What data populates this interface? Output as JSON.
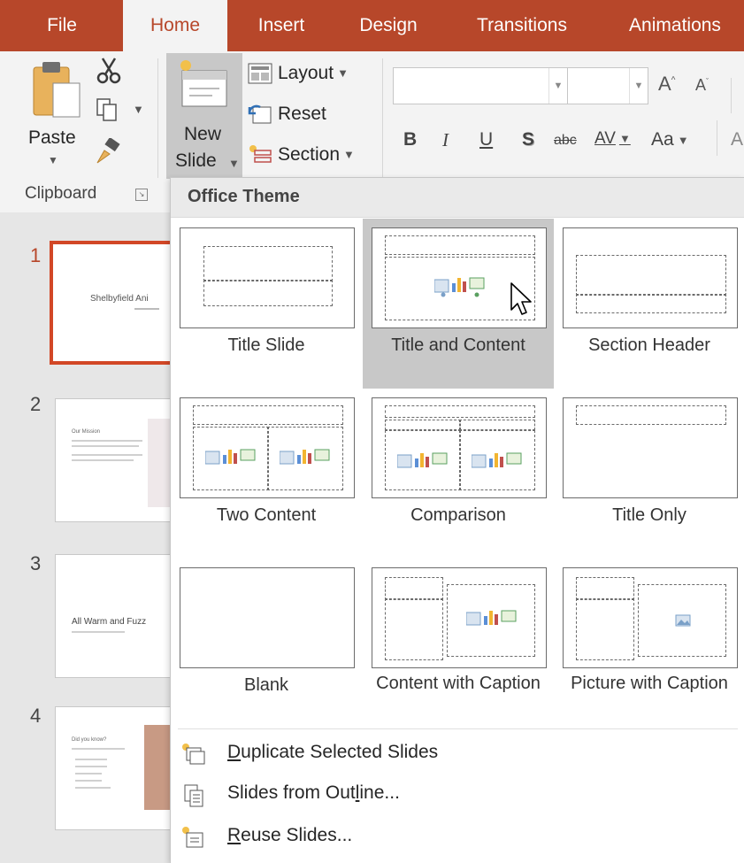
{
  "tabs": [
    "File",
    "Home",
    "Insert",
    "Design",
    "Transitions",
    "Animations"
  ],
  "active_tab": "Home",
  "accent": "#b7472a",
  "ribbon": {
    "paste": "Paste",
    "new_slide_line1": "New",
    "new_slide_line2": "Slide",
    "layout": "Layout",
    "reset": "Reset",
    "section": "Section",
    "format": {
      "bold": "B",
      "italic": "I",
      "underline": "U",
      "shadow": "S",
      "strike": "abc",
      "spacing": "AV",
      "case": "Aa"
    },
    "clipboard_group": "Clipboard"
  },
  "slides": [
    {
      "number": "1",
      "title": "Shelbyfield Ani"
    },
    {
      "number": "2",
      "title": "Our Mission"
    },
    {
      "number": "3",
      "title": "All Warm and Fuzz"
    },
    {
      "number": "4",
      "title": "Did you know?"
    }
  ],
  "menu": {
    "header": "Office Theme",
    "layouts": [
      "Title Slide",
      "Title and Content",
      "Section Header",
      "Two Content",
      "Comparison",
      "Title Only",
      "Blank",
      "Content with Caption",
      "Picture with Caption"
    ],
    "commands": {
      "duplicate_a": "D",
      "duplicate_b": "uplicate Selected Slides",
      "outline_a": "Slides from Out",
      "outline_b": "l",
      "outline_c": "ine...",
      "reuse_a": "R",
      "reuse_b": "euse Slides..."
    }
  }
}
